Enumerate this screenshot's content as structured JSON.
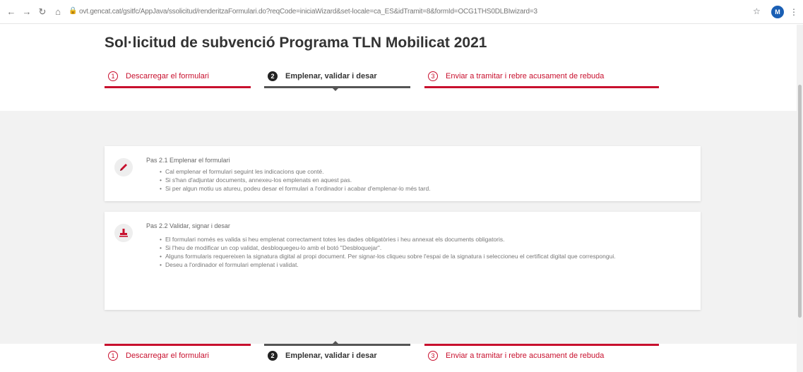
{
  "browser": {
    "url": "ovt.gencat.cat/gsitfc/AppJava/ssolicitud/renderitzaFormulari.do?reqCode=iniciaWizard&set-locale=ca_ES&idTramit=8&formId=OCG1THS0DLBIwizard=3",
    "back_icon": "←",
    "forward_icon": "→",
    "reload_icon": "↻",
    "home_icon": "⌂",
    "lock_icon": "🔒",
    "star_icon": "☆",
    "profile_initial": "M",
    "menu_icon": "⋮"
  },
  "page": {
    "title": "Sol·licitud de subvenció Programa TLN Mobilicat 2021"
  },
  "steps": [
    {
      "num": "1",
      "label": "Descarregar el formulari",
      "state": "inactive"
    },
    {
      "num": "2",
      "label": "Emplenar, validar i desar",
      "state": "active"
    },
    {
      "num": "3",
      "label": "Enviar a tramitar i rebre acusament de rebuda",
      "state": "inactive"
    }
  ],
  "cards": [
    {
      "title": "Pas 2.1 Emplenar el formulari",
      "icon": "pencil-icon",
      "items": [
        "Cal emplenar el formulari seguint les indicacions que conté.",
        "Si s'han d'adjuntar documents, annexeu-los emplenats en aquest pas.",
        "Si per algun motiu us atureu, podeu desar el formulari a l'ordinador i acabar d'emplenar-lo més tard."
      ]
    },
    {
      "title": "Pas 2.2 Validar, signar i desar",
      "icon": "stamp-icon",
      "items": [
        "El formulari només es valida si heu emplenat correctament totes les dades obligatòries i heu annexat els documents obligatoris.",
        "Si l'heu de modificar un cop validat, desbloquegeu-lo amb el botó \"Desbloquejar\".",
        "Alguns formularis requereixen la signatura digital al propi document. Per signar-los cliqueu sobre l'espai de la signatura i seleccioneu el certificat digital que correspongui.",
        "Deseu a l'ordinador el formulari emplenat i validat."
      ]
    }
  ],
  "colors": {
    "accent": "#c8102e",
    "active": "#555555",
    "background_grey": "#f2f2f2"
  }
}
